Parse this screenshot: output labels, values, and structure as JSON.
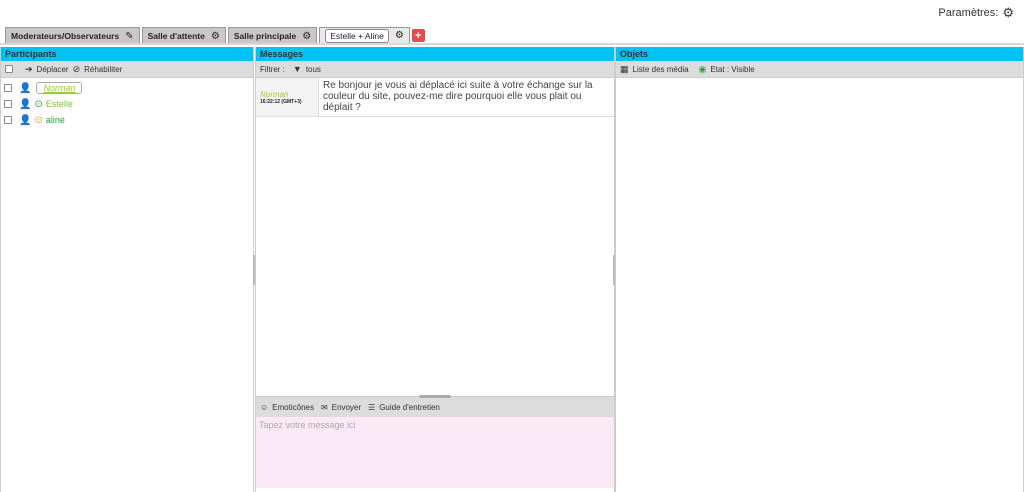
{
  "header": {
    "params_label": "Paramètres:",
    "params_icon": "gears-icon"
  },
  "tabs": [
    {
      "label": "Moderateurs/Observateurs",
      "icon": "pencil-icon"
    },
    {
      "label": "Salle d'attente",
      "icon": "gear-icon"
    },
    {
      "label": "Salle principale",
      "icon": "gear-icon"
    },
    {
      "label": "Estelle + Aline",
      "icon": "gear-icon",
      "active": true
    }
  ],
  "tab_add": "+",
  "participants": {
    "title": "Participants",
    "move_label": "Déplacer",
    "rehab_label": "Réhabiliter",
    "list": [
      {
        "name": "Norman",
        "role": "moderator",
        "color": "#3a5fd1"
      },
      {
        "name": "Estelle",
        "status": "online",
        "color": "#2a9d3c"
      },
      {
        "name": "aline",
        "status": "away",
        "color": "#e8a020"
      }
    ]
  },
  "messages": {
    "title": "Messages",
    "filter_label": "Filtrer :",
    "filter_value": "tous",
    "items": [
      {
        "author": "Norman",
        "time": "16:22:12 (GMT+3)",
        "text": "Re bonjour je vous ai déplacé ici suite à votre échange sur la couleur du site, pouvez-me dire pourquoi elle vous plait ou déplait ?"
      }
    ],
    "emoticons_label": "Emoticônes",
    "send_label": "Envoyer",
    "guide_label": "Guide d'entretien",
    "input_placeholder": "Tapez votre message ici"
  },
  "objects": {
    "title": "Objets",
    "media_label": "Liste des média",
    "state_label": "Etat : Visible"
  },
  "colors": {
    "header_bg": "#00c3f3",
    "input_bg": "#fbe9f5",
    "add_tab": "#e84a4a"
  }
}
